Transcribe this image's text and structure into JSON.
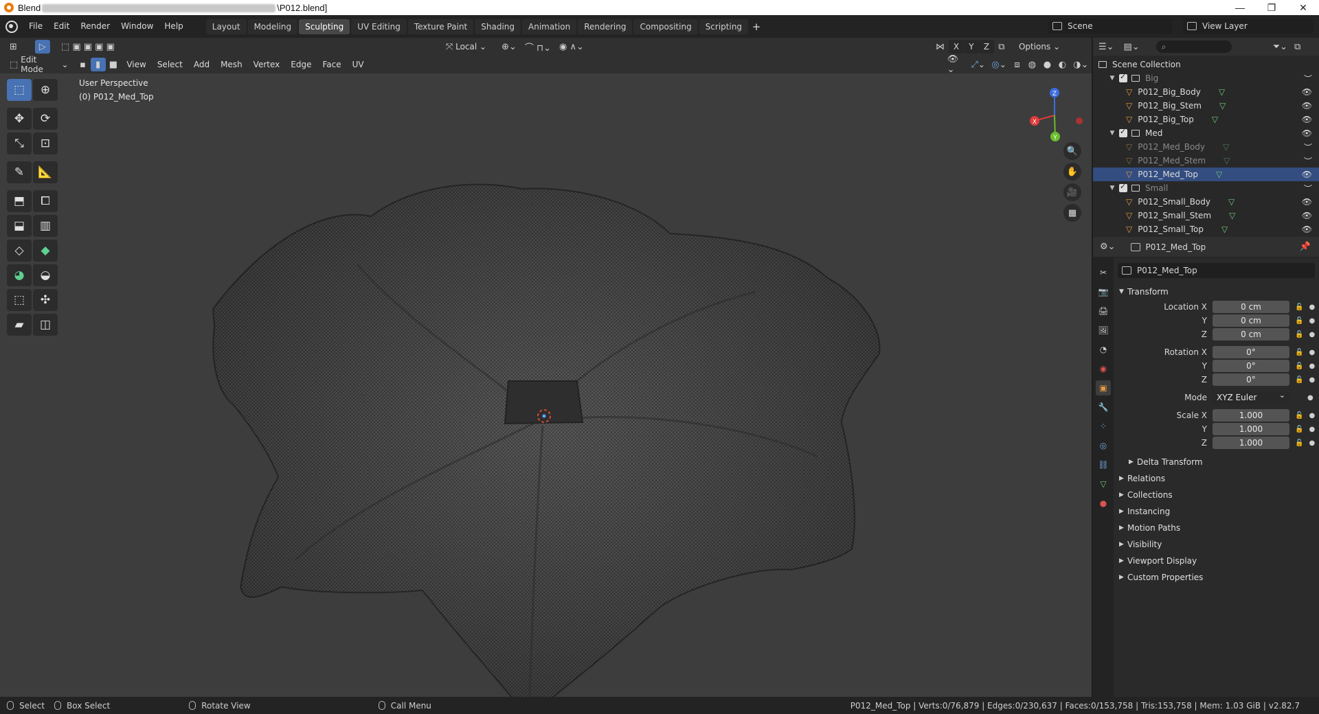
{
  "titlebar": {
    "title_prefix": "Blend",
    "title_suffix": "\\P012.blend]",
    "minimize": "—",
    "maximize": "❐",
    "close": "✕"
  },
  "menu": [
    "File",
    "Edit",
    "Render",
    "Window",
    "Help"
  ],
  "workspaces": [
    "Layout",
    "Modeling",
    "Sculpting",
    "UV Editing",
    "Texture Paint",
    "Shading",
    "Animation",
    "Rendering",
    "Compositing",
    "Scripting"
  ],
  "active_workspace": "Sculpting",
  "scene": {
    "label": "Scene",
    "view_layer": "View Layer"
  },
  "viewport_header": {
    "orientation": "Local",
    "axes": [
      "X",
      "Y",
      "Z"
    ],
    "options": "Options",
    "mode": "Edit Mode",
    "menus": [
      "View",
      "Select",
      "Add",
      "Mesh",
      "Vertex",
      "Edge",
      "Face",
      "UV"
    ]
  },
  "viewport_info": {
    "view": "User Perspective",
    "object": "(0) P012_Med_Top"
  },
  "gizmo": {
    "x": "X",
    "y": "Y",
    "z": "Z",
    "color_x": "#e23b3b",
    "color_y": "#6bbd2e",
    "color_z": "#3b6de2"
  },
  "outliner": {
    "root": "Scene Collection",
    "rows": [
      {
        "label": "Big",
        "type": "collection",
        "dim": true
      },
      {
        "label": "P012_Big_Body",
        "type": "mesh"
      },
      {
        "label": "P012_Big_Stem",
        "type": "mesh"
      },
      {
        "label": "P012_Big_Top",
        "type": "mesh"
      },
      {
        "label": "Med",
        "type": "collection"
      },
      {
        "label": "P012_Med_Body",
        "type": "mesh",
        "dim": true
      },
      {
        "label": "P012_Med_Stem",
        "type": "mesh",
        "dim": true
      },
      {
        "label": "P012_Med_Top",
        "type": "mesh",
        "selected": true
      },
      {
        "label": "Small",
        "type": "collection",
        "dim": true
      },
      {
        "label": "P012_Small_Body",
        "type": "mesh"
      },
      {
        "label": "P012_Small_Stem",
        "type": "mesh"
      },
      {
        "label": "P012_Small_Top",
        "type": "mesh"
      }
    ]
  },
  "properties": {
    "object_name": "P012_Med_Top",
    "name_field": "P012_Med_Top",
    "transform_title": "Transform",
    "location": {
      "label": "Location X",
      "x": "0 cm",
      "y": "0 cm",
      "z": "0 cm"
    },
    "rotation": {
      "label": "Rotation X",
      "x": "0°",
      "y": "0°",
      "z": "0°"
    },
    "mode": {
      "label": "Mode",
      "value": "XYZ Euler"
    },
    "scale": {
      "label": "Scale X",
      "x": "1.000",
      "y": "1.000",
      "z": "1.000"
    },
    "axis_y": "Y",
    "axis_z": "Z",
    "delta": "Delta Transform",
    "panels": [
      "Relations",
      "Collections",
      "Instancing",
      "Motion Paths",
      "Visibility",
      "Viewport Display",
      "Custom Properties"
    ]
  },
  "statusbar": {
    "select": "Select",
    "box_select": "Box Select",
    "rotate": "Rotate View",
    "call_menu": "Call Menu",
    "stats": "P012_Med_Top | Verts:0/76,879 | Edges:0/230,637 | Faces:0/153,758 | Tris:153,758 | Mem: 1.03 GiB | v2.82.7"
  },
  "colors": {
    "accent": "#4772b3",
    "selection": "#334d80",
    "mesh": "#e69a45",
    "data": "#74c87a"
  }
}
